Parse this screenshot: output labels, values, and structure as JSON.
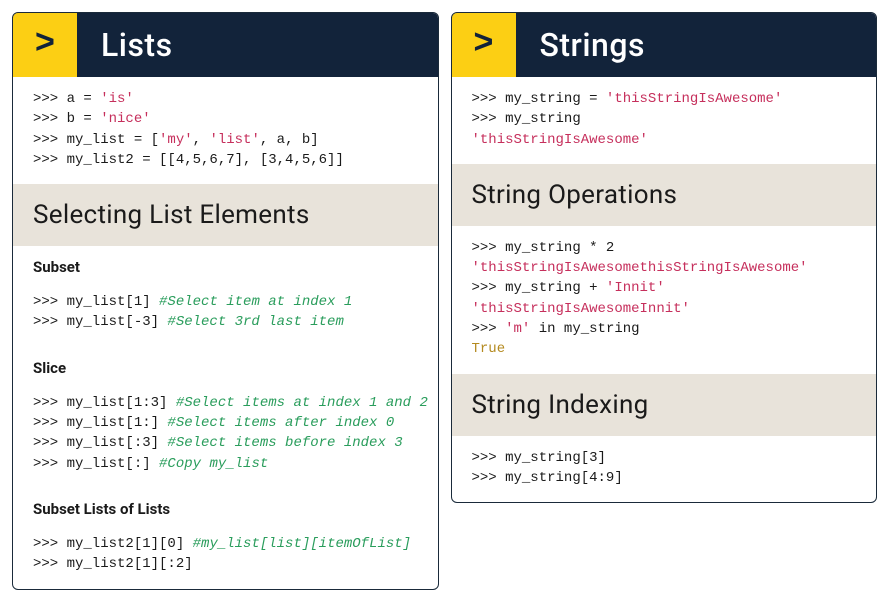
{
  "left": {
    "badge": ">",
    "title": "Lists",
    "intro": [
      [
        {
          "t": ">>> a = "
        },
        {
          "t": "'is'",
          "c": "str"
        }
      ],
      [
        {
          "t": ">>> b = "
        },
        {
          "t": "'nice'",
          "c": "str"
        }
      ],
      [
        {
          "t": ">>> my_list = ["
        },
        {
          "t": "'my'",
          "c": "str"
        },
        {
          "t": ", "
        },
        {
          "t": "'list'",
          "c": "str"
        },
        {
          "t": ", a, b]"
        }
      ],
      [
        {
          "t": ">>> my_list2 = [[4,5,6,7], [3,4,5,6]]"
        }
      ]
    ],
    "section1_title": "Selecting List Elements",
    "sub1_title": "Subset",
    "sub1_code": [
      [
        {
          "t": ">>> my_list[1] "
        },
        {
          "t": "#Select item at index 1",
          "c": "com"
        }
      ],
      [
        {
          "t": ">>> my_list[-3] "
        },
        {
          "t": "#Select 3rd last item",
          "c": "com"
        }
      ]
    ],
    "sub2_title": "Slice",
    "sub2_code": [
      [
        {
          "t": ">>> my_list[1:3] "
        },
        {
          "t": "#Select items at index 1 and 2",
          "c": "com"
        }
      ],
      [
        {
          "t": ">>> my_list[1:] "
        },
        {
          "t": "#Select items after index 0",
          "c": "com"
        }
      ],
      [
        {
          "t": ">>> my_list[:3] "
        },
        {
          "t": "#Select items before index 3",
          "c": "com"
        }
      ],
      [
        {
          "t": ">>> my_list[:] "
        },
        {
          "t": "#Copy my_list",
          "c": "com"
        }
      ]
    ],
    "sub3_title": "Subset Lists of Lists",
    "sub3_code": [
      [
        {
          "t": ">>> my_list2[1][0] "
        },
        {
          "t": "#my_list[list][itemOfList]",
          "c": "com"
        }
      ],
      [
        {
          "t": ">>> my_list2[1][:2]"
        }
      ]
    ]
  },
  "right": {
    "badge": ">",
    "title": "Strings",
    "intro": [
      [
        {
          "t": ">>> my_string = "
        },
        {
          "t": "'thisStringIsAwesome'",
          "c": "str"
        }
      ],
      [
        {
          "t": ">>> my_string"
        }
      ],
      [
        {
          "t": "'thisStringIsAwesome'",
          "c": "str"
        }
      ]
    ],
    "section1_title": "String Operations",
    "section1_code": [
      [
        {
          "t": ">>> my_string * 2"
        }
      ],
      [
        {
          "t": "'thisStringIsAwesomethisStringIsAwesome'",
          "c": "str"
        }
      ],
      [
        {
          "t": ">>> my_string + "
        },
        {
          "t": "'Innit'",
          "c": "str"
        }
      ],
      [
        {
          "t": "'thisStringIsAwesomeInnit'",
          "c": "str"
        }
      ],
      [
        {
          "t": ">>> "
        },
        {
          "t": "'m'",
          "c": "str"
        },
        {
          "t": " in my_string"
        }
      ],
      [
        {
          "t": "True",
          "c": "true"
        }
      ]
    ],
    "section2_title": "String Indexing",
    "section2_code": [
      [
        {
          "t": ">>> my_string[3]"
        }
      ],
      [
        {
          "t": ">>> my_string[4:9]"
        }
      ]
    ]
  }
}
